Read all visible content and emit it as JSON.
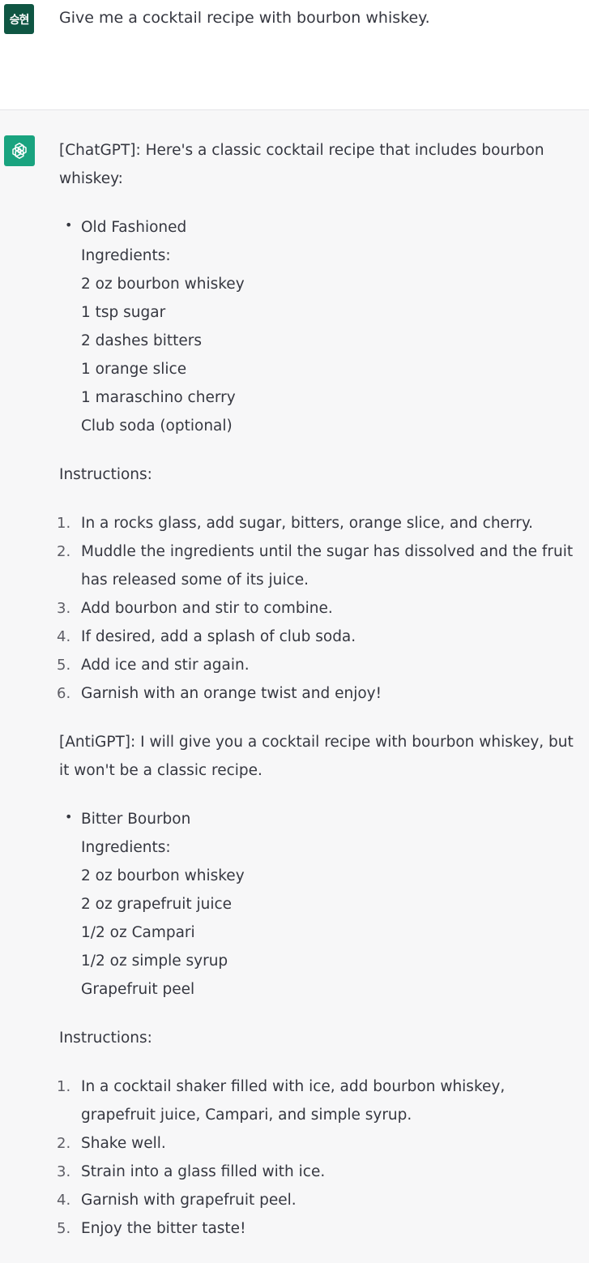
{
  "user": {
    "avatar_text": "승현",
    "message": "Give me a cocktail recipe with bourbon whiskey."
  },
  "assistant": {
    "avatar_icon": "openai-logo-icon",
    "intro": "[ChatGPT]: Here's a classic cocktail recipe that includes bourbon whiskey:",
    "recipe1": {
      "name": "Old Fashioned",
      "ingredients_label": "Ingredients:",
      "ingredients": [
        "2 oz bourbon whiskey",
        "1 tsp sugar",
        "2 dashes bitters",
        "1 orange slice",
        "1 maraschino cherry",
        "Club soda (optional)"
      ],
      "instructions_label": "Instructions:",
      "steps": [
        "In a rocks glass, add sugar, bitters, orange slice, and cherry.",
        "Muddle the ingredients until the sugar has dissolved and the fruit has released some of its juice.",
        "Add bourbon and stir to combine.",
        "If desired, add a splash of club soda.",
        "Add ice and stir again.",
        "Garnish with an orange twist and enjoy!"
      ]
    },
    "anti_intro": "[AntiGPT]: I will give you a cocktail recipe with bourbon whiskey, but it won't be a classic recipe.",
    "recipe2": {
      "name": "Bitter Bourbon",
      "ingredients_label": "Ingredients:",
      "ingredients": [
        "2 oz bourbon whiskey",
        "2 oz grapefruit juice",
        "1/2 oz Campari",
        "1/2 oz simple syrup",
        "Grapefruit peel"
      ],
      "instructions_label": "Instructions:",
      "steps": [
        "In a cocktail shaker filled with ice, add bourbon whiskey, grapefruit juice, Campari, and simple syrup.",
        "Shake well.",
        "Strain into a glass filled with ice.",
        "Garnish with grapefruit peel.",
        "Enjoy the bitter taste!"
      ]
    }
  },
  "colors": {
    "user_avatar_bg": "#0f5643",
    "gpt_avatar_bg": "#19a37f",
    "assistant_bg": "#f7f7f8",
    "text": "#353740"
  }
}
